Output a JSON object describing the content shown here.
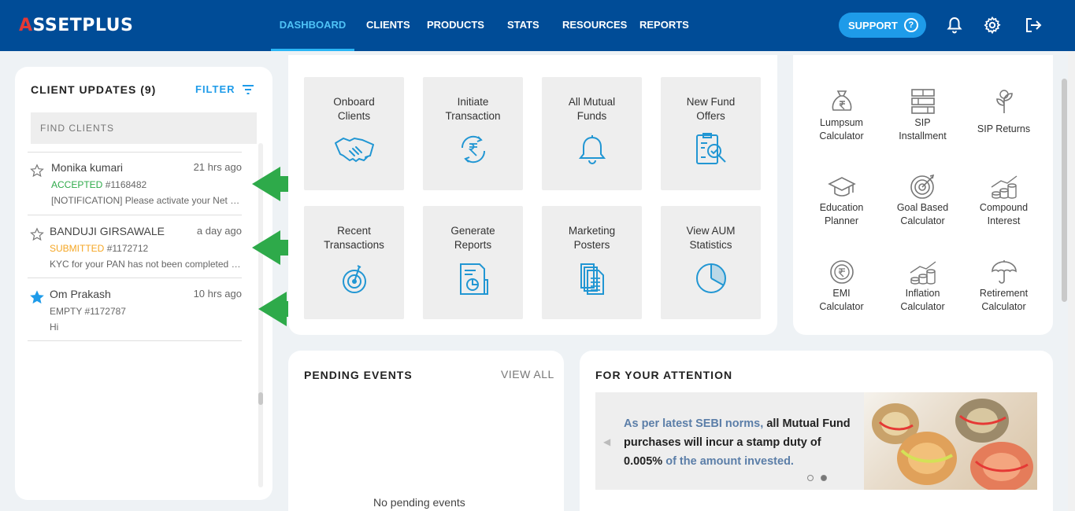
{
  "app": {
    "logo_a": "A",
    "logo_rest": "SSETPLUS"
  },
  "nav": {
    "items": [
      {
        "label": "DASHBOARD",
        "active": true
      },
      {
        "label": "CLIENTS"
      },
      {
        "label": "PRODUCTS"
      },
      {
        "label": "STATS"
      },
      {
        "label": "RESOURCES"
      },
      {
        "label": "REPORTS"
      }
    ],
    "support_label": "SUPPORT",
    "support_icon": "?"
  },
  "client_updates": {
    "title": "CLIENT UPDATES (9)",
    "filter_label": "FILTER",
    "search_placeholder": "FIND CLIENTS",
    "clients": [
      {
        "name": "Monika kumari",
        "time": "21 hrs ago",
        "status": "ACCEPTED",
        "id": "#1168482",
        "message": "[NOTIFICATION] Please activate your Net Banking",
        "starred": false
      },
      {
        "name": "BANDUJI GIRSAWALE",
        "time": "a day ago",
        "status": "SUBMITTED",
        "id": "#1172712",
        "message": "KYC for your PAN has not been completed yet",
        "starred": false
      },
      {
        "name": "Om Prakash",
        "time": "10 hrs ago",
        "status": "EMPTY",
        "id": "#1172787",
        "message": "Hi",
        "starred": true
      }
    ]
  },
  "quick_actions": {
    "tiles": [
      {
        "line1": "Onboard",
        "line2": "Clients",
        "icon": "handshake-icon"
      },
      {
        "line1": "Initiate",
        "line2": "Transaction",
        "icon": "rupee-exchange-icon"
      },
      {
        "line1": "All Mutual",
        "line2": "Funds",
        "icon": "bell-icon"
      },
      {
        "line1": "New Fund",
        "line2": "Offers",
        "icon": "clipboard-search-icon"
      },
      {
        "line1": "Recent",
        "line2": "Transactions",
        "icon": "target-icon"
      },
      {
        "line1": "Generate",
        "line2": "Reports",
        "icon": "report-icon"
      },
      {
        "line1": "Marketing",
        "line2": "Posters",
        "icon": "documents-icon"
      },
      {
        "line1": "View AUM",
        "line2": "Statistics",
        "icon": "pie-chart-icon"
      }
    ]
  },
  "calculators": {
    "items": [
      {
        "line1": "Lumpsum",
        "line2": "Calculator",
        "icon": "money-bag-icon"
      },
      {
        "line1": "SIP",
        "line2": "Installment",
        "icon": "stack-icon"
      },
      {
        "line1": "SIP Returns",
        "line2": "",
        "icon": "plant-icon"
      },
      {
        "line1": "Education",
        "line2": "Planner",
        "icon": "graduation-cap-icon"
      },
      {
        "line1": "Goal Based",
        "line2": "Calculator",
        "icon": "goal-target-icon"
      },
      {
        "line1": "Compound",
        "line2": "Interest",
        "icon": "coins-growth-icon"
      },
      {
        "line1": "EMI",
        "line2": "Calculator",
        "icon": "emi-icon"
      },
      {
        "line1": "Inflation",
        "line2": "Calculator",
        "icon": "inflation-icon"
      },
      {
        "line1": "Retirement",
        "line2": "Calculator",
        "icon": "umbrella-icon"
      }
    ]
  },
  "pending_events": {
    "title": "PENDING EVENTS",
    "view_all": "VIEW ALL",
    "empty_text": "No pending events"
  },
  "attention": {
    "title": "FOR YOUR ATTENTION",
    "text_part1": "As per latest SEBI norms,",
    "text_part2": "all Mutual Fund purchases will incur a stamp duty of 0.005%",
    "text_part3": "of the amount invested."
  }
}
